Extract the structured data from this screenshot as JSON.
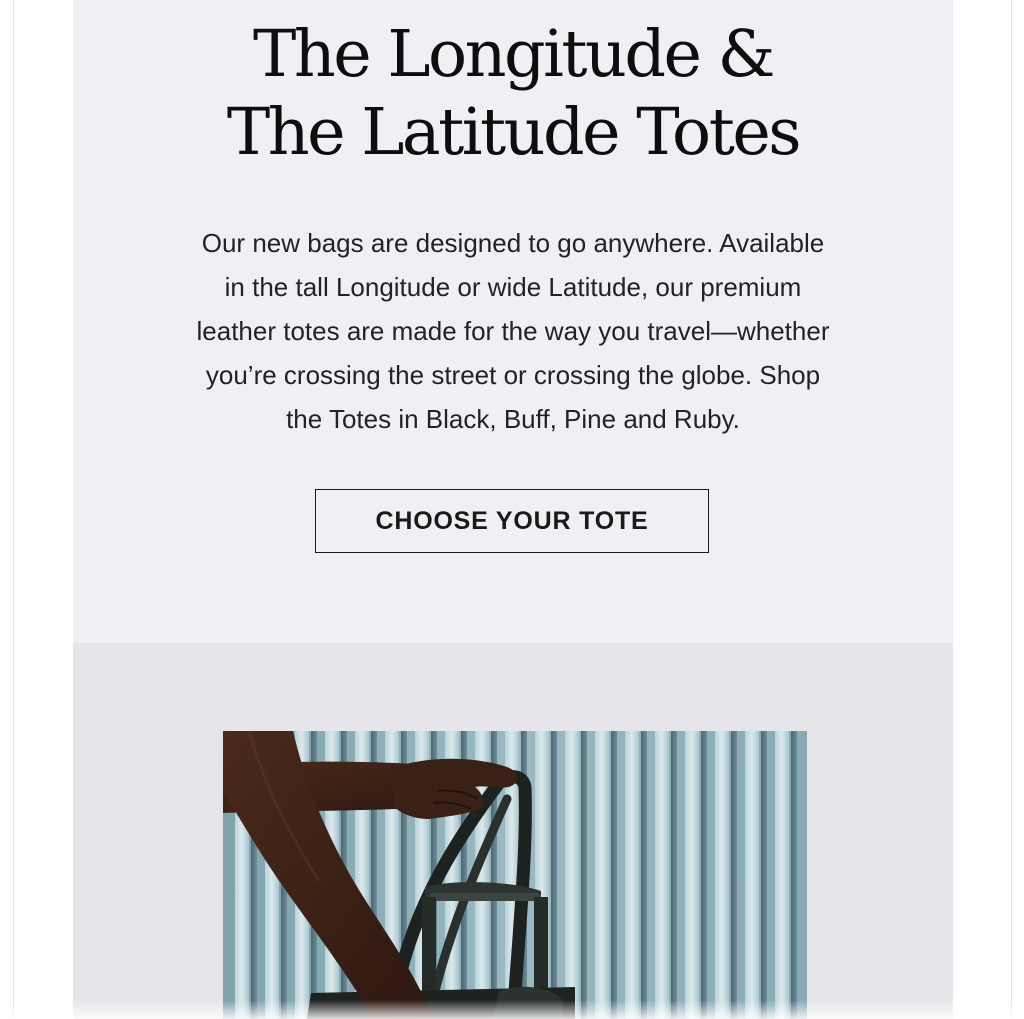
{
  "hero": {
    "title_line1": "The Longitude &",
    "title_line2": "The Latitude Totes",
    "body_lines": [
      "Our new bags are designed to go anywhere. Available",
      "in the tall Longitude or wide Latitude, our premium",
      "leather totes are made for the way you travel—whether",
      "you’re crossing the street or crossing the globe. Shop",
      "the Totes in Black, Buff, Pine and Ruby."
    ],
    "cta_label": "CHOOSE YOUR TOTE"
  },
  "colors": {
    "hero_background": "#f0f0f4",
    "image_section_background": "#e6e6ea",
    "text": "#0e0e0e",
    "button_border": "#1a1a1a"
  },
  "icons": {
    "product_photo": "tote-bag-photo"
  }
}
